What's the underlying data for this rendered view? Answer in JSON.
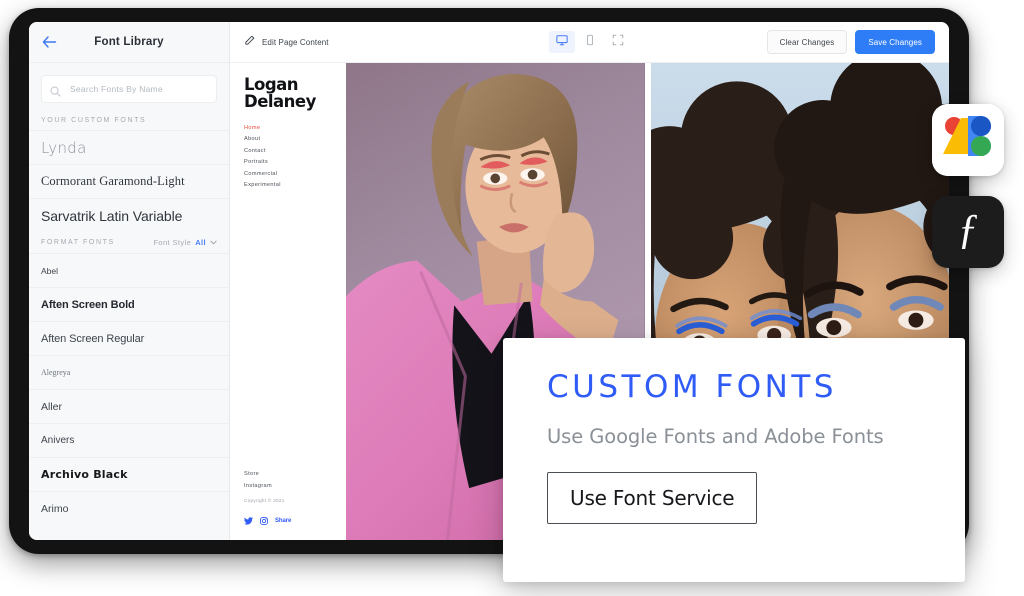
{
  "sidebar": {
    "title": "Font Library",
    "back_icon": "arrow-left-icon",
    "search": {
      "icon": "search-icon",
      "placeholder": "Search Fonts By Name",
      "value": ""
    },
    "custom_section_label": "YOUR CUSTOM FONTS",
    "custom_fonts": [
      {
        "name": "Lynda",
        "style_class": "fr-lynda"
      },
      {
        "name": "Cormorant Garamond-Light",
        "style_class": "fr-cormorant"
      },
      {
        "name": "Sarvatrik Latin Variable",
        "style_class": "fr-sarvatrik"
      }
    ],
    "format_section_label": "FORMAT FONTS",
    "filter": {
      "label": "Font Style",
      "value": "All",
      "chevron": "chevron-down-icon"
    },
    "format_fonts": [
      {
        "name": "Abel",
        "style_class": "fr-abel"
      },
      {
        "name": "Aften Screen Bold",
        "style_class": "fr-aftenbold"
      },
      {
        "name": "Aften Screen Regular",
        "style_class": "fr-aftenreg"
      },
      {
        "name": "Alegreya",
        "style_class": "fr-alegreya"
      },
      {
        "name": "Aller",
        "style_class": "fr-aller"
      },
      {
        "name": "Anivers",
        "style_class": "fr-anivers"
      },
      {
        "name": "Archivo Black",
        "style_class": "fr-archivo"
      },
      {
        "name": "Arimo",
        "style_class": "fr-arimo"
      }
    ]
  },
  "toolbar": {
    "edit_icon": "pencil-icon",
    "edit_label": "Edit Page Content",
    "devices": [
      {
        "icon": "desktop-icon",
        "name": "desktop-view-button",
        "active": true
      },
      {
        "icon": "mobile-icon",
        "name": "mobile-view-button",
        "active": false
      },
      {
        "icon": "fullscreen-icon",
        "name": "fullscreen-button",
        "active": false
      }
    ],
    "clear_label": "Clear Changes",
    "save_label": "Save Changes",
    "primary_color": "#2f7df6"
  },
  "site_preview": {
    "name_line1": "Logan",
    "name_line2": "Delaney",
    "nav": [
      {
        "label": "Home",
        "active": true
      },
      {
        "label": "About",
        "active": false
      },
      {
        "label": "Contact",
        "active": false
      },
      {
        "label": "Portraits",
        "active": false
      },
      {
        "label": "Commercial",
        "active": false
      },
      {
        "label": "Experimental",
        "active": false
      }
    ],
    "footer_links": [
      {
        "label": "Store"
      },
      {
        "label": "Instagram"
      }
    ],
    "copyright": "Copyright © 2021",
    "social": [
      {
        "icon": "twitter-icon"
      },
      {
        "icon": "instagram-icon"
      }
    ],
    "share_label": "Share",
    "active_nav_color": "#e8463c",
    "share_color": "#2f5bf6",
    "photos": [
      {
        "name": "photo-woman-pink-blazer",
        "bg": "#8d7687"
      },
      {
        "name": "photo-two-people-blue-eyeliner",
        "bg": "#5c4336"
      }
    ]
  },
  "logos": [
    {
      "name": "google-fonts-logo",
      "label": "Google Fonts"
    },
    {
      "name": "adobe-fonts-logo",
      "label": "Adobe Fonts",
      "glyph": "ƒ"
    }
  ],
  "custom_fonts_card": {
    "title": "CUSTOM FONTS",
    "subtitle": "Use Google Fonts and Adobe Fonts",
    "button_label": "Use Font Service",
    "title_color": "#2f5bf6"
  }
}
